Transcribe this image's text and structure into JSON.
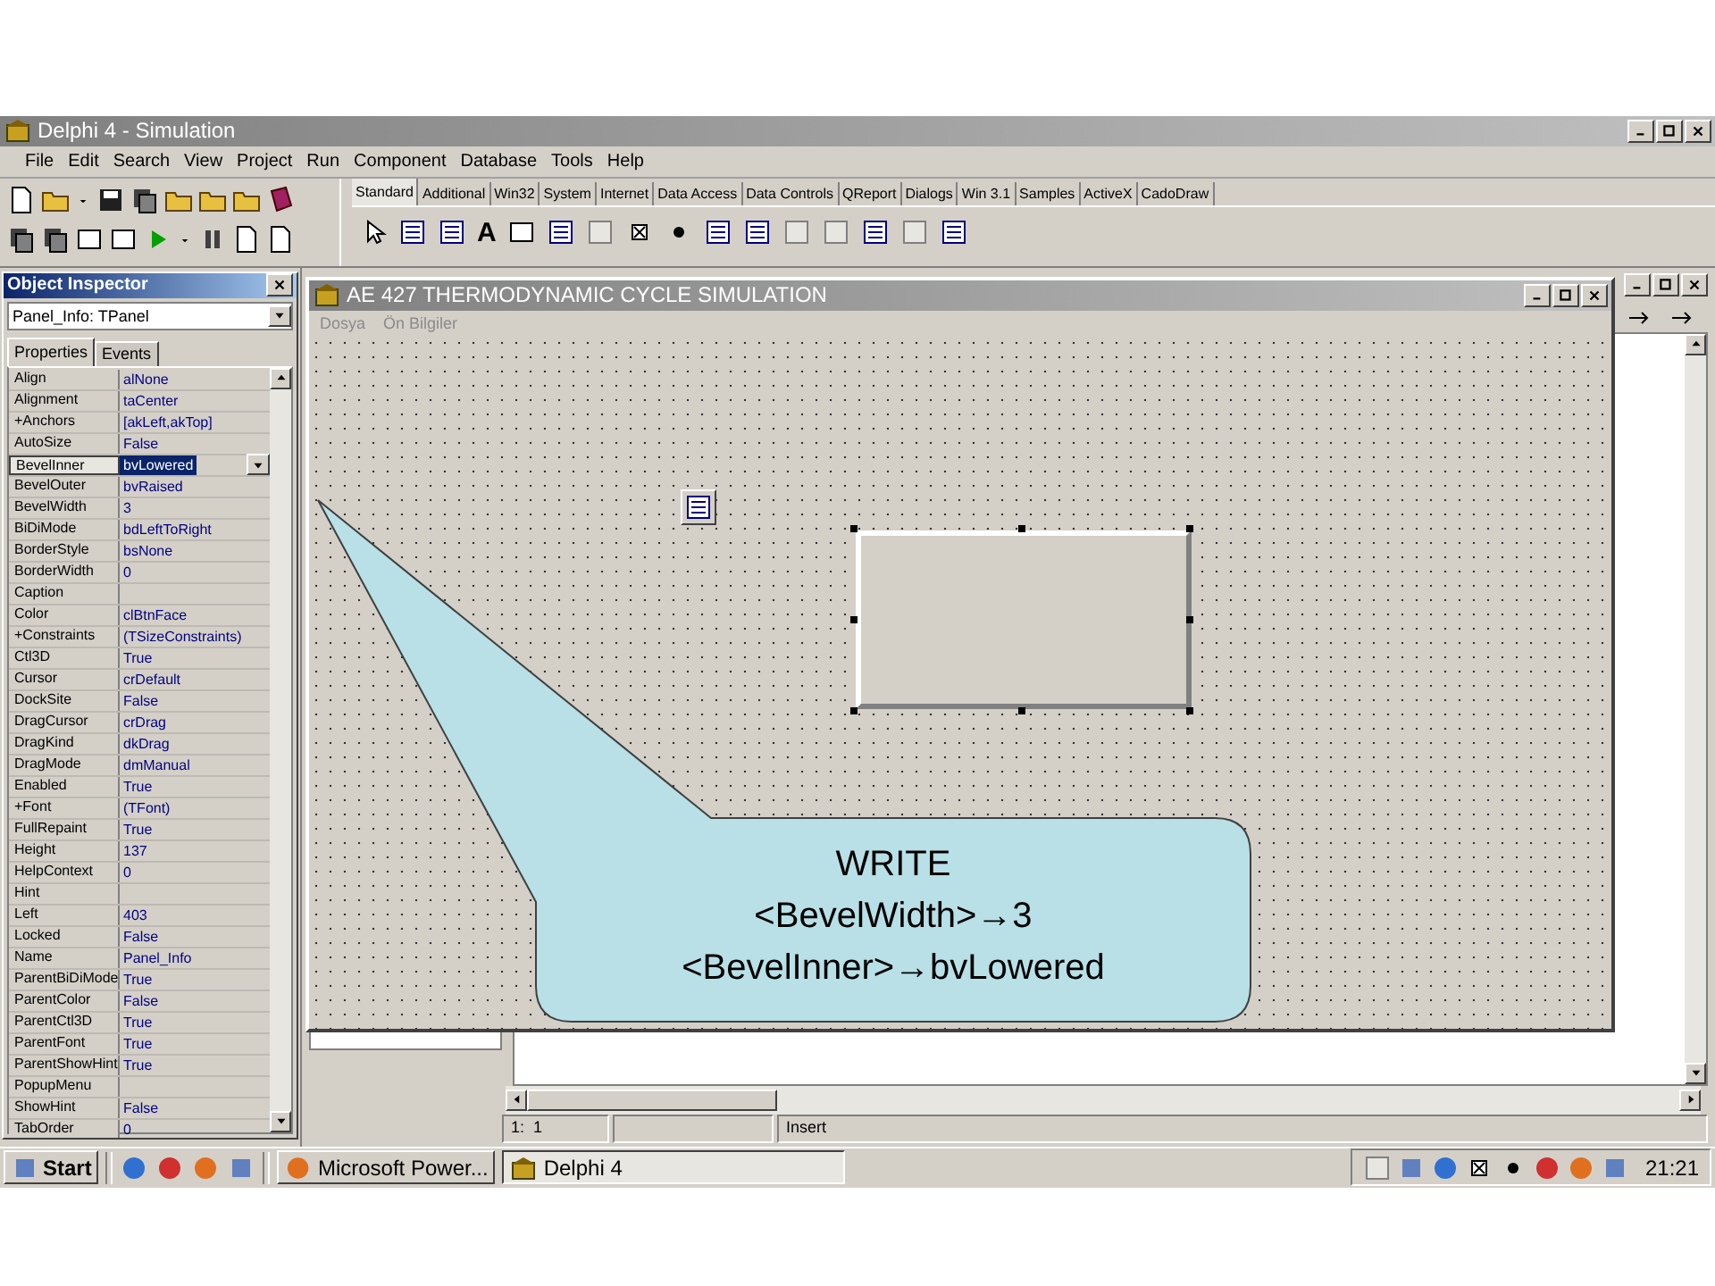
{
  "window": {
    "title": "Delphi 4 - Simulation"
  },
  "menu": [
    {
      "label": "File"
    },
    {
      "label": "Edit"
    },
    {
      "label": "Search"
    },
    {
      "label": "View"
    },
    {
      "label": "Project"
    },
    {
      "label": "Run"
    },
    {
      "label": "Component"
    },
    {
      "label": "Database"
    },
    {
      "label": "Tools"
    },
    {
      "label": "Help"
    }
  ],
  "component_palette": {
    "tabs": [
      {
        "label": "Standard",
        "selected": true
      },
      {
        "label": "Additional",
        "selected": false
      },
      {
        "label": "Win32",
        "selected": false
      },
      {
        "label": "System",
        "selected": false
      },
      {
        "label": "Internet",
        "selected": false
      },
      {
        "label": "Data Access",
        "selected": false
      },
      {
        "label": "Data Controls",
        "selected": false
      },
      {
        "label": "QReport",
        "selected": false
      },
      {
        "label": "Dialogs",
        "selected": false
      },
      {
        "label": "Win 3.1",
        "selected": false
      },
      {
        "label": "Samples",
        "selected": false
      },
      {
        "label": "ActiveX",
        "selected": false
      },
      {
        "label": "CadoDraw",
        "selected": false
      }
    ],
    "label_tool_glyph": "A"
  },
  "object_inspector": {
    "title": "Object Inspector",
    "object_selector": "Panel_Info: TPanel",
    "tabs": [
      {
        "label": "Properties",
        "selected": true
      },
      {
        "label": "Events",
        "selected": false
      }
    ],
    "properties": [
      {
        "name": "Align",
        "value": "alNone",
        "selected": false
      },
      {
        "name": "Alignment",
        "value": "taCenter",
        "selected": false
      },
      {
        "name": "+Anchors",
        "value": "[akLeft,akTop]",
        "selected": false
      },
      {
        "name": "AutoSize",
        "value": "False",
        "selected": false
      },
      {
        "name": "BevelInner",
        "value": "bvLowered",
        "selected": true
      },
      {
        "name": "BevelOuter",
        "value": "bvRaised",
        "selected": false
      },
      {
        "name": "BevelWidth",
        "value": "3",
        "selected": false
      },
      {
        "name": "BiDiMode",
        "value": "bdLeftToRight",
        "selected": false
      },
      {
        "name": "BorderStyle",
        "value": "bsNone",
        "selected": false
      },
      {
        "name": "BorderWidth",
        "value": "0",
        "selected": false
      },
      {
        "name": "Caption",
        "selected": false
      },
      {
        "name": "Color",
        "value": "clBtnFace",
        "selected": false
      },
      {
        "name": "+Constraints",
        "value": "(TSizeConstraints)",
        "selected": false
      },
      {
        "name": "Ctl3D",
        "value": "True",
        "selected": false
      },
      {
        "name": "Cursor",
        "value": "crDefault",
        "selected": false
      },
      {
        "name": "DockSite",
        "value": "False",
        "selected": false
      },
      {
        "name": "DragCursor",
        "value": "crDrag",
        "selected": false
      },
      {
        "name": "DragKind",
        "value": "dkDrag",
        "selected": false
      },
      {
        "name": "DragMode",
        "value": "dmManual",
        "selected": false
      },
      {
        "name": "Enabled",
        "value": "True",
        "selected": false
      },
      {
        "name": "+Font",
        "value": "(TFont)",
        "selected": false
      },
      {
        "name": "FullRepaint",
        "value": "True",
        "selected": false
      },
      {
        "name": "Height",
        "value": "137",
        "selected": false
      },
      {
        "name": "HelpContext",
        "value": "0",
        "selected": false
      },
      {
        "name": "Hint",
        "selected": false
      },
      {
        "name": "Left",
        "value": "403",
        "selected": false
      },
      {
        "name": "Locked",
        "value": "False",
        "selected": false
      },
      {
        "name": "Name",
        "value": "Panel_Info",
        "selected": false
      },
      {
        "name": "ParentBiDiMode",
        "value": "True",
        "selected": false
      },
      {
        "name": "ParentColor",
        "value": "False",
        "selected": false
      },
      {
        "name": "ParentCtl3D",
        "value": "True",
        "selected": false
      },
      {
        "name": "ParentFont",
        "value": "True",
        "selected": false
      },
      {
        "name": "ParentShowHint",
        "value": "True",
        "selected": false
      },
      {
        "name": "PopupMenu",
        "selected": false
      },
      {
        "name": "ShowHint",
        "value": "False",
        "selected": false
      },
      {
        "name": "TabOrder",
        "value": "0",
        "selected": false
      }
    ]
  },
  "form_window": {
    "title": "AE 427 THERMODYNAMIC CYCLE SIMULATION",
    "menu": [
      {
        "label": "Dosya",
        "disabled": true
      },
      {
        "label": "Ön Bilgiler",
        "disabled": true
      }
    ]
  },
  "editor_status": {
    "position": "1:  1",
    "mode": "Insert"
  },
  "taskbar": {
    "start": "Start",
    "tasks": [
      {
        "label": "Microsoft Power...",
        "selected": false
      },
      {
        "label": "Delphi 4",
        "selected": true
      }
    ],
    "clock": "21:21"
  },
  "callout": {
    "lines": [
      "WRITE",
      "<BevelWidth>→3",
      "<BevelInner>→bvLowered"
    ]
  }
}
